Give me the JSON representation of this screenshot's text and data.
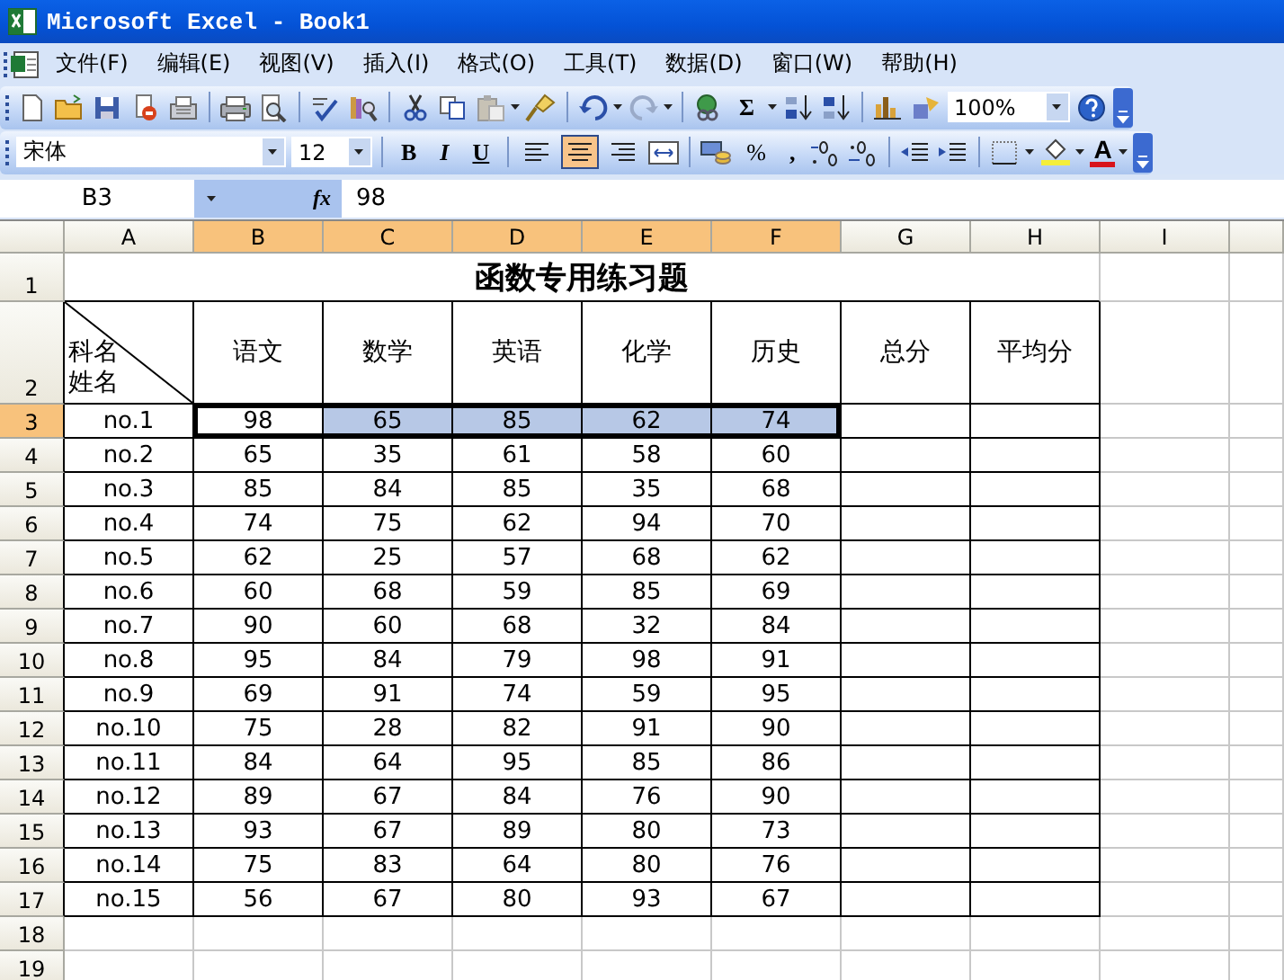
{
  "window": {
    "title": "Microsoft Excel - Book1"
  },
  "menu": [
    {
      "label": "文件(F)"
    },
    {
      "label": "编辑(E)"
    },
    {
      "label": "视图(V)"
    },
    {
      "label": "插入(I)"
    },
    {
      "label": "格式(O)"
    },
    {
      "label": "工具(T)"
    },
    {
      "label": "数据(D)"
    },
    {
      "label": "窗口(W)"
    },
    {
      "label": "帮助(H)"
    }
  ],
  "standard_toolbar": {
    "autosum": "Σ",
    "zoom": "100%"
  },
  "formatting_toolbar": {
    "font": "宋体",
    "size": "12",
    "bold": "B",
    "italic": "I",
    "underline": "U",
    "percent": "%",
    "comma": ",",
    "font_color": "A",
    "align": [
      {
        "kind": "left",
        "selected": false
      },
      {
        "kind": "center",
        "selected": true
      },
      {
        "kind": "right",
        "selected": false
      }
    ]
  },
  "formula_bar": {
    "name_box": "B3",
    "fx": "fx",
    "value": "98"
  },
  "sheet": {
    "columns": [
      {
        "label": "A",
        "selected": false
      },
      {
        "label": "B",
        "selected": true
      },
      {
        "label": "C",
        "selected": true
      },
      {
        "label": "D",
        "selected": true
      },
      {
        "label": "E",
        "selected": true
      },
      {
        "label": "F",
        "selected": true
      },
      {
        "label": "G",
        "selected": false
      },
      {
        "label": "H",
        "selected": false
      },
      {
        "label": "I",
        "selected": false
      }
    ],
    "row_numbers": [
      {
        "label": "1",
        "selected": false
      },
      {
        "label": "2",
        "selected": false
      },
      {
        "label": "3",
        "selected": true
      },
      {
        "label": "4",
        "selected": false
      },
      {
        "label": "5",
        "selected": false
      },
      {
        "label": "6",
        "selected": false
      },
      {
        "label": "7",
        "selected": false
      },
      {
        "label": "8",
        "selected": false
      },
      {
        "label": "9",
        "selected": false
      },
      {
        "label": "10",
        "selected": false
      },
      {
        "label": "11",
        "selected": false
      },
      {
        "label": "12",
        "selected": false
      },
      {
        "label": "13",
        "selected": false
      },
      {
        "label": "14",
        "selected": false
      },
      {
        "label": "15",
        "selected": false
      },
      {
        "label": "16",
        "selected": false
      },
      {
        "label": "17",
        "selected": false
      },
      {
        "label": "18",
        "selected": false
      },
      {
        "label": "19",
        "selected": false
      }
    ],
    "title": "函数专用练习题",
    "corner_top": "科名",
    "corner_bottom": "姓名",
    "subjects": [
      "语文",
      "数学",
      "英语",
      "化学",
      "历史",
      "总分",
      "平均分"
    ],
    "records": [
      {
        "name": "no.1",
        "scores": [
          "98",
          "65",
          "85",
          "62",
          "74"
        ],
        "selected": true
      },
      {
        "name": "no.2",
        "scores": [
          "65",
          "35",
          "61",
          "58",
          "60"
        ],
        "selected": false
      },
      {
        "name": "no.3",
        "scores": [
          "85",
          "84",
          "85",
          "35",
          "68"
        ],
        "selected": false
      },
      {
        "name": "no.4",
        "scores": [
          "74",
          "75",
          "62",
          "94",
          "70"
        ],
        "selected": false
      },
      {
        "name": "no.5",
        "scores": [
          "62",
          "25",
          "57",
          "68",
          "62"
        ],
        "selected": false
      },
      {
        "name": "no.6",
        "scores": [
          "60",
          "68",
          "59",
          "85",
          "69"
        ],
        "selected": false
      },
      {
        "name": "no.7",
        "scores": [
          "90",
          "60",
          "68",
          "32",
          "84"
        ],
        "selected": false
      },
      {
        "name": "no.8",
        "scores": [
          "95",
          "84",
          "79",
          "98",
          "91"
        ],
        "selected": false
      },
      {
        "name": "no.9",
        "scores": [
          "69",
          "91",
          "74",
          "59",
          "95"
        ],
        "selected": false
      },
      {
        "name": "no.10",
        "scores": [
          "75",
          "28",
          "82",
          "91",
          "90"
        ],
        "selected": false
      },
      {
        "name": "no.11",
        "scores": [
          "84",
          "64",
          "95",
          "85",
          "86"
        ],
        "selected": false
      },
      {
        "name": "no.12",
        "scores": [
          "89",
          "67",
          "84",
          "76",
          "90"
        ],
        "selected": false
      },
      {
        "name": "no.13",
        "scores": [
          "93",
          "67",
          "89",
          "80",
          "73"
        ],
        "selected": false
      },
      {
        "name": "no.14",
        "scores": [
          "75",
          "83",
          "64",
          "80",
          "76"
        ],
        "selected": false
      },
      {
        "name": "no.15",
        "scores": [
          "56",
          "67",
          "80",
          "93",
          "67"
        ],
        "selected": false
      }
    ]
  }
}
